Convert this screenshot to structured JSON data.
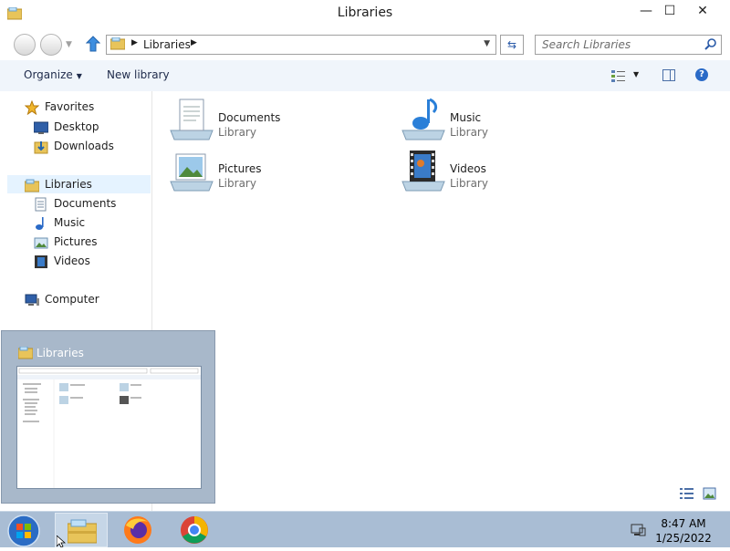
{
  "window": {
    "title": "Libraries",
    "controls": {
      "minimize": "—",
      "maximize": "☐",
      "close": "✕"
    }
  },
  "navbar": {
    "address_crumbs": [
      "Libraries"
    ],
    "search_placeholder": "Search Libraries"
  },
  "toolbar": {
    "organize_label": "Organize",
    "new_library_label": "New library"
  },
  "nav_pane": {
    "favorites": {
      "label": "Favorites",
      "icon": "star-icon"
    },
    "favorites_items": [
      {
        "label": "Desktop",
        "icon": "desktop-icon"
      },
      {
        "label": "Downloads",
        "icon": "downloads-icon"
      }
    ],
    "libraries": {
      "label": "Libraries",
      "icon": "libraries-icon",
      "selected": true
    },
    "libraries_items": [
      {
        "label": "Documents",
        "icon": "documents-icon"
      },
      {
        "label": "Music",
        "icon": "music-icon"
      },
      {
        "label": "Pictures",
        "icon": "pictures-icon"
      },
      {
        "label": "Videos",
        "icon": "videos-icon"
      }
    ],
    "computer": {
      "label": "Computer",
      "icon": "computer-icon"
    }
  },
  "content": {
    "libraries": [
      {
        "name": "Documents",
        "type": "Library",
        "icon": "documents-library-icon"
      },
      {
        "name": "Music",
        "type": "Library",
        "icon": "music-library-icon"
      },
      {
        "name": "Pictures",
        "type": "Library",
        "icon": "pictures-library-icon"
      },
      {
        "name": "Videos",
        "type": "Library",
        "icon": "videos-library-icon"
      }
    ]
  },
  "preview": {
    "title": "Libraries"
  },
  "taskbar": {
    "apps": [
      "start-orb-icon",
      "explorer-icon",
      "firefox-icon",
      "chrome-icon"
    ],
    "clock_time": "8:47 AM",
    "clock_date": "1/25/2022"
  },
  "colors": {
    "toolbar_bg": "#f0f5fb",
    "taskbar_bg": "#a9bdd4",
    "selection_bg": "#e5f3ff",
    "preview_bg": "#a8b8ca"
  }
}
